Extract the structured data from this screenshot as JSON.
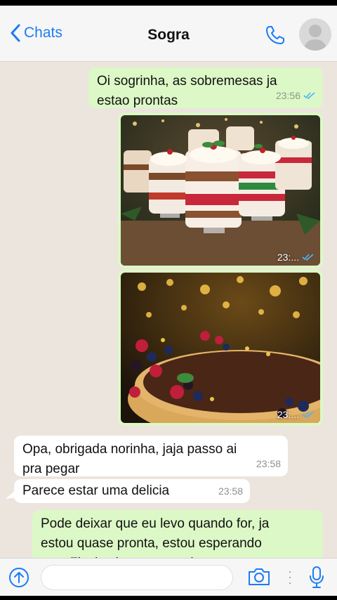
{
  "header": {
    "back_label": "Chats",
    "title": "Sogra"
  },
  "messages": [
    {
      "text_line1": "Oi sogrinha, as sobremesas ja",
      "text_line2": "estao prontas",
      "time": "23:56"
    },
    {
      "image": "christmas-trifle-desserts",
      "time": "23:..."
    },
    {
      "image": "berry-chocolate-tart",
      "time": "23:..."
    },
    {
      "text_line1": "Opa, obrigada norinha, jaja passo ai",
      "text_line2": "pra pegar",
      "time": "23:58"
    },
    {
      "text_line1": "Parece estar uma delicia",
      "time": "23:58"
    },
    {
      "text_line1": "Pode deixar que eu levo quando for, ja",
      "text_line2": "estou quase pronta, estou esperando",
      "text_line3": "so o Flavio chegar pra colocar a"
    }
  ],
  "colors": {
    "outgoing_bubble": "#dcf8c6",
    "incoming_bubble": "#ffffff",
    "chat_background": "#ece5dd",
    "accent": "#1a7cf5",
    "read_ticks": "#4fb3f6"
  }
}
